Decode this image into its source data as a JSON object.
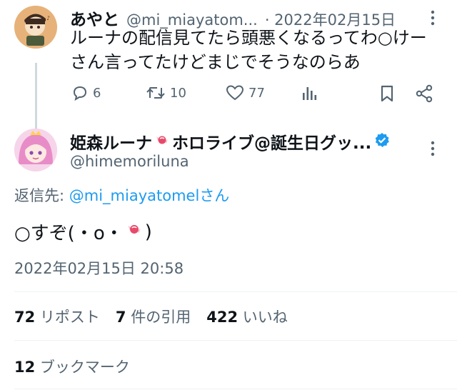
{
  "parent_tweet": {
    "display_name": "あやと",
    "handle": "@mi_miayatom...",
    "date": "· 2022年02月15日",
    "text_line1": "ルーナの配信見てたら頭悪くなるってわ○けー",
    "text_line2": "さん言ってたけどまじでそうなのらあ",
    "reply_count": "6",
    "retweet_count": "10",
    "like_count": "77"
  },
  "main_tweet": {
    "display_name_part1": "姫森ルーナ",
    "display_name_part2": "ホロライブ@誕生日グッ...",
    "handle": "@himemoriluna",
    "reply_to_prefix": "返信先: ",
    "reply_to_handle": "@mi_miayatomel",
    "reply_to_suffix": "さん",
    "text_part1": "○すぞ(・o・",
    "text_part2": ")",
    "timestamp": "2022年02月15日 20:58"
  },
  "stats": {
    "reposts_count": "72",
    "reposts_label": "リポスト",
    "quotes_count": "7",
    "quotes_label": "件の引用",
    "likes_count": "422",
    "likes_label": "いいね",
    "bookmarks_count": "12",
    "bookmarks_label": "ブックマーク"
  },
  "colors": {
    "accent": "#1d9bf0",
    "secondary_text": "#536471",
    "divider": "#eff3f4"
  }
}
